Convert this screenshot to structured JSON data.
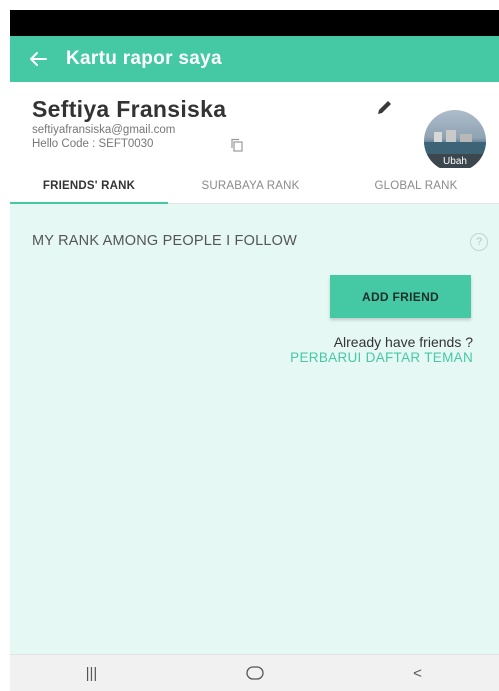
{
  "app_bar": {
    "title": "Kartu rapor saya",
    "back_icon": "arrow-left-icon",
    "color": "#45c9a4"
  },
  "profile": {
    "name": "Seftiya Fransiska",
    "email": "seftiyafransiska@gmail.com",
    "hello_code": "Hello Code : SEFT0030",
    "avatar_label": "Ubah",
    "edit_icon": "pencil-icon",
    "copy_icon": "copy-icon"
  },
  "tabs": [
    {
      "label": "FRIENDS' RANK",
      "active": true
    },
    {
      "label": "SURABAYA RANK",
      "active": false
    },
    {
      "label": "GLOBAL RANK",
      "active": false
    }
  ],
  "content": {
    "section_title": "MY RANK AMONG PEOPLE I FOLLOW",
    "help_icon": "?",
    "add_friend_label": "ADD FRIEND",
    "already_text": "Already have friends ?",
    "update_link": "PERBARUI DAFTAR TEMAN",
    "background": "#e6f8f3"
  },
  "nav_bar": {
    "recent_label": "|||",
    "home_icon": "home-circle-icon",
    "back_label": "<"
  }
}
